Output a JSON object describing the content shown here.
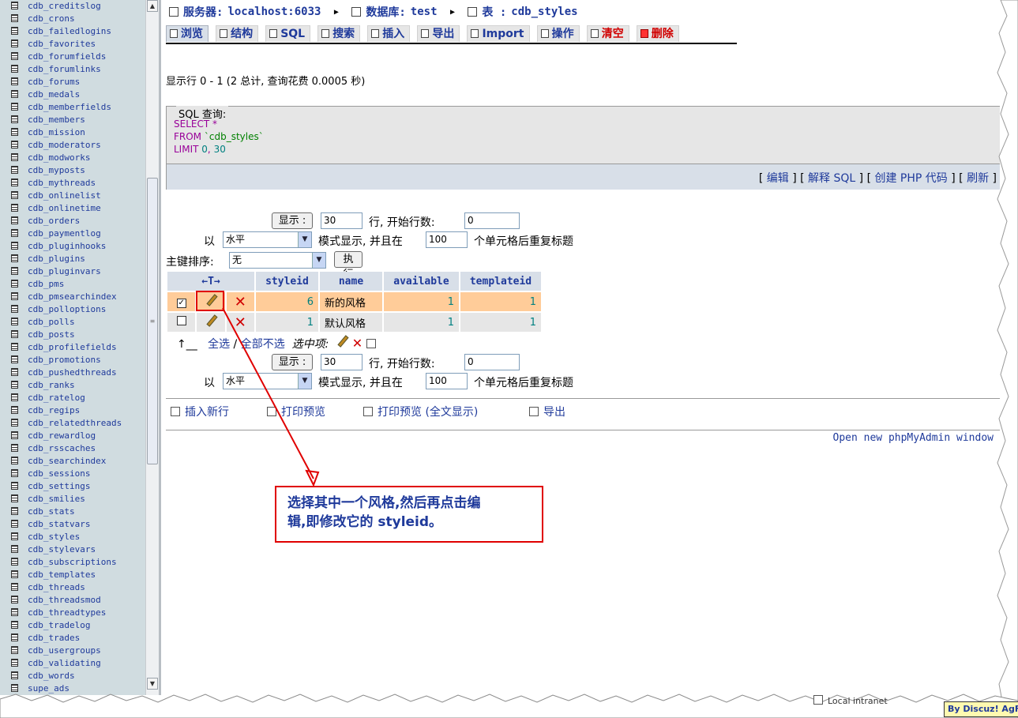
{
  "sidebar": {
    "tables": [
      "cdb_creditslog",
      "cdb_crons",
      "cdb_failedlogins",
      "cdb_favorites",
      "cdb_forumfields",
      "cdb_forumlinks",
      "cdb_forums",
      "cdb_medals",
      "cdb_memberfields",
      "cdb_members",
      "cdb_mission",
      "cdb_moderators",
      "cdb_modworks",
      "cdb_myposts",
      "cdb_mythreads",
      "cdb_onlinelist",
      "cdb_onlinetime",
      "cdb_orders",
      "cdb_paymentlog",
      "cdb_pluginhooks",
      "cdb_plugins",
      "cdb_pluginvars",
      "cdb_pms",
      "cdb_pmsearchindex",
      "cdb_polloptions",
      "cdb_polls",
      "cdb_posts",
      "cdb_profilefields",
      "cdb_promotions",
      "cdb_pushedthreads",
      "cdb_ranks",
      "cdb_ratelog",
      "cdb_regips",
      "cdb_relatedthreads",
      "cdb_rewardlog",
      "cdb_rsscaches",
      "cdb_searchindex",
      "cdb_sessions",
      "cdb_settings",
      "cdb_smilies",
      "cdb_stats",
      "cdb_statvars",
      "cdb_styles",
      "cdb_stylevars",
      "cdb_subscriptions",
      "cdb_templates",
      "cdb_threads",
      "cdb_threadsmod",
      "cdb_threadtypes",
      "cdb_tradelog",
      "cdb_trades",
      "cdb_usergroups",
      "cdb_validating",
      "cdb_words",
      "supe_ads"
    ]
  },
  "breadcrumb": {
    "server_label": "服务器:",
    "server_value": "localhost:6033",
    "db_label": "数据库:",
    "db_value": "test",
    "table_label": "表 :",
    "table_value": "cdb_styles"
  },
  "tabs": {
    "browse": "浏览",
    "structure": "结构",
    "sql": "SQL",
    "search": "搜索",
    "insert": "插入",
    "export": "导出",
    "import": "Import",
    "operations": "操作",
    "empty": "清空",
    "drop": "删除"
  },
  "rows_info": "显示行 0 - 1 (2 总计, 查询花费 0.0005 秒)",
  "sql": {
    "legend": "SQL 查询:",
    "select_kw": "SELECT",
    "select_star": "*",
    "from_kw": "FROM",
    "from_table": "`cdb_styles`",
    "limit_kw": "LIMIT",
    "limit_start": "0",
    "limit_comma": ",",
    "limit_count": "30",
    "link_edit": "编辑",
    "link_explain": "解释 SQL",
    "link_php": "创建 PHP 代码",
    "link_refresh": "刷新"
  },
  "nav_top": {
    "show_button": "显示 :",
    "rows_value": "30",
    "rows_label": "行, 开始行数:",
    "start_value": "0",
    "mode_prefix": "以",
    "mode_value": "水平",
    "mode_suffix": "模式显示, 并且在",
    "repeat_value": "100",
    "repeat_suffix": "个单元格后重复标题"
  },
  "sort": {
    "label": "主键排序:",
    "value": "无",
    "go_button": "执行"
  },
  "table": {
    "arrows": "←T→",
    "columns": [
      "styleid",
      "name",
      "available",
      "templateid"
    ],
    "rows": [
      {
        "checked": "✓",
        "styleid": "6",
        "name": "新的风格",
        "available": "1",
        "templateid": "1"
      },
      {
        "checked": "",
        "styleid": "1",
        "name": "默认风格",
        "available": "1",
        "templateid": "1"
      }
    ]
  },
  "bulk": {
    "arrow": "↑__",
    "check_all": "全选",
    "slash": "/",
    "uncheck_all": "全部不选",
    "with_selected": "选中项:"
  },
  "bottom_links": {
    "insert_row": "插入新行",
    "print_view": "打印预览",
    "print_view_full": "打印预览 (全文显示)",
    "export": "导出",
    "open_new": "Open new phpMyAdmin window"
  },
  "annotation": {
    "line1": "选择其中一个风格,然后再点击编",
    "line2": "辑,即修改它的 styleid。"
  },
  "status": {
    "zone": "Local intranet",
    "badge": "By Discuz! AgFx"
  },
  "colors": {
    "link_blue": "#1f3a9b",
    "selected_row": "#ffcc99",
    "highlight_red": "#e00000"
  }
}
